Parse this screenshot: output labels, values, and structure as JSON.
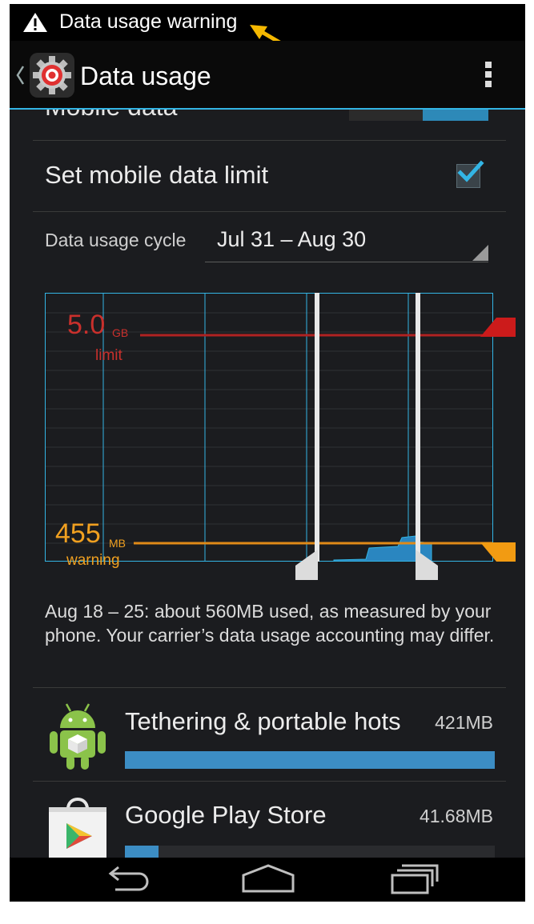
{
  "status_bar": {
    "notification_text": "Data usage warning",
    "notification_icon": "warning-triangle-icon"
  },
  "action_bar": {
    "title": "Data usage",
    "app_icon": "settings-gear-icon",
    "overflow_icon": "overflow-menu-icon"
  },
  "settings": {
    "mobile_data_label": "Mobile data",
    "mobile_data_toggle": "on",
    "set_limit_label": "Set mobile data limit",
    "set_limit_checked": true,
    "cycle_label": "Data usage cycle",
    "cycle_value": "Jul 31 – Aug 30"
  },
  "chart": {
    "limit_value": "5.0",
    "limit_unit": "GB",
    "limit_word": "limit",
    "warning_value": "455",
    "warning_unit": "MB",
    "warning_word": "warning"
  },
  "chart_data": {
    "type": "area",
    "limit_gb": 5.0,
    "warning_mb": 455,
    "selected_range": "Aug 18 – 25",
    "colors": {
      "limit": "#c9302c",
      "warning": "#f0a020",
      "usage": "#33b5e5",
      "grid": "#33b5e5"
    }
  },
  "usage_summary": "Aug 18 – 25: about 560MB used, as measured by your phone. Your carrier’s data usage accounting may differ.",
  "apps": [
    {
      "name": "Tethering & portable hots",
      "size": "421MB",
      "icon": "android-robot-icon",
      "usage_fraction": 1.0
    },
    {
      "name": "Google Play Store",
      "size": "41.68MB",
      "icon": "play-store-bag-icon",
      "usage_fraction": 0.09
    }
  ],
  "nav": {
    "back_icon": "back-arrow-icon",
    "home_icon": "home-icon",
    "recents_icon": "recent-apps-icon"
  },
  "colors": {
    "accent": "#33b5e5",
    "limit_red": "#c9302c",
    "warning_orange": "#f0a020",
    "annotation_arrow": "#f5b800"
  }
}
